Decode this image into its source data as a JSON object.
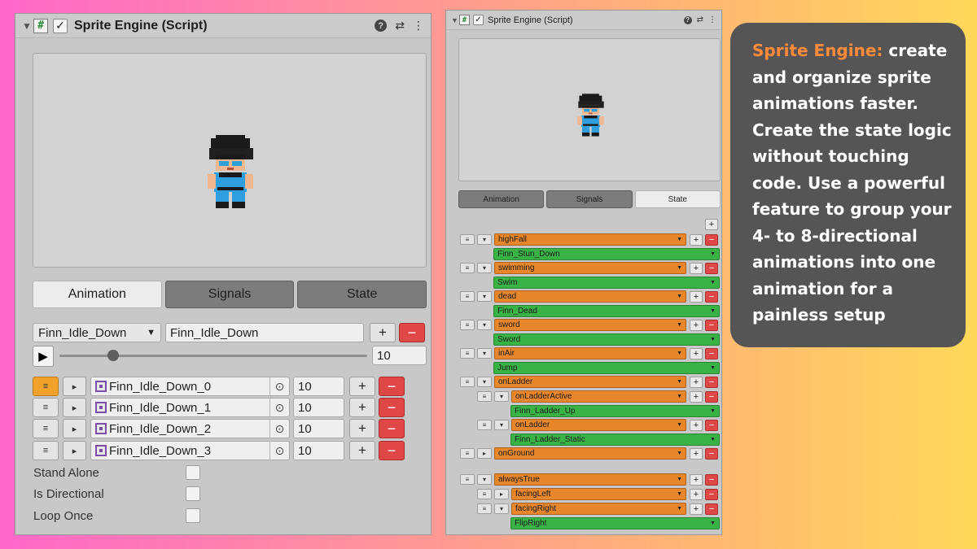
{
  "left_panel": {
    "title": "Sprite Engine (Script)",
    "tabs": [
      "Animation",
      "Signals",
      "State"
    ],
    "active_tab": "Animation",
    "animation_dropdown": "Finn_Idle_Down",
    "animation_name": "Finn_Idle_Down",
    "fps": "10",
    "frames": [
      {
        "name": "Finn_Idle_Down_0",
        "duration": "10"
      },
      {
        "name": "Finn_Idle_Down_1",
        "duration": "10"
      },
      {
        "name": "Finn_Idle_Down_2",
        "duration": "10"
      },
      {
        "name": "Finn_Idle_Down_3",
        "duration": "10"
      }
    ],
    "options": [
      "Stand Alone",
      "Is Directional",
      "Loop Once"
    ]
  },
  "right_panel": {
    "title": "Sprite Engine (Script)",
    "tabs": [
      "Animation",
      "Signals",
      "State"
    ],
    "active_tab": "State",
    "states": [
      {
        "signal": "highFall",
        "animation": "Finn_Stun_Down"
      },
      {
        "signal": "swimming",
        "animation": "Swim"
      },
      {
        "signal": "dead",
        "animation": "Finn_Dead"
      },
      {
        "signal": "sword",
        "animation": "Sword"
      },
      {
        "signal": "inAir",
        "animation": "Jump"
      },
      {
        "signal": "onLadder"
      },
      {
        "signal": "onLadderActive",
        "animation": "Finn_Ladder_Up"
      },
      {
        "signal": "onLadder",
        "animation": "Finn_Ladder_Static"
      },
      {
        "signal": "onGround"
      },
      {
        "signal": "alwaysTrue"
      },
      {
        "signal": "facingLeft"
      },
      {
        "signal": "facingRight",
        "animation": "FlipRight"
      }
    ]
  },
  "callout": {
    "highlight": "Sprite Engine:",
    "text": " create and organize sprite animations faster. Create the state logic without touching code. Use a powerful feature to group your 4- to 8-directional animations into one animation for a painless setup"
  },
  "colors": {
    "signal_bar": "#e8862c",
    "animation_bar": "#3ab346",
    "remove_button": "#e04848",
    "callout_bg": "#555555",
    "callout_accent": "#ff8a3a"
  },
  "icons": [
    "script-icon",
    "checkbox-icon",
    "help-icon",
    "settings-sliders-icon",
    "kebab-menu-icon",
    "play-icon",
    "drag-handle-icon",
    "sprite-frame-icon",
    "object-picker-icon",
    "dropdown-caret-icon"
  ]
}
